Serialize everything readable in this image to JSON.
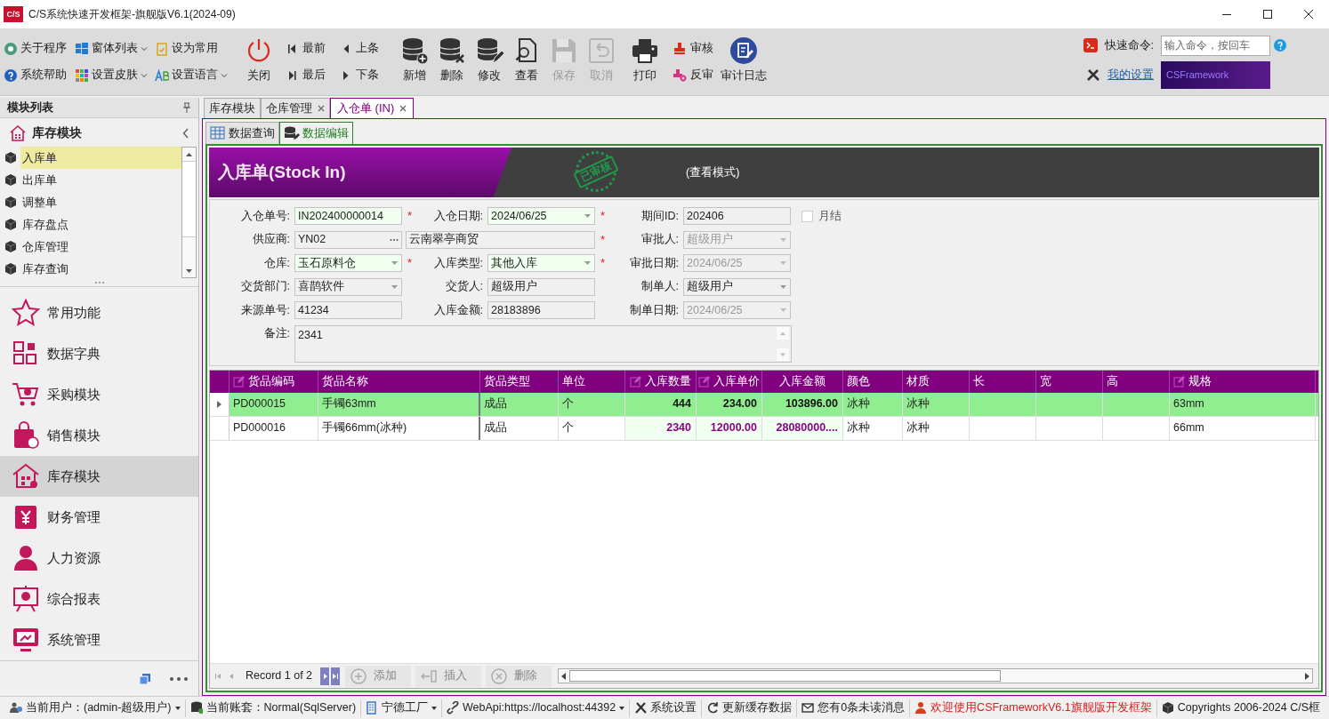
{
  "window": {
    "logo": "C/S",
    "title": "C/S系统快速开发框架-旗舰版V6.1(2024-09)"
  },
  "toolbar": {
    "menu_buttons": [
      {
        "label": "关于程序",
        "dropdown": false
      },
      {
        "label": "窗体列表",
        "dropdown": true
      },
      {
        "label": "设为常用",
        "dropdown": false
      },
      {
        "label": "系统帮助",
        "dropdown": false
      },
      {
        "label": "设置皮肤",
        "dropdown": true
      },
      {
        "label": "设置语言",
        "dropdown": true
      }
    ],
    "close": "关闭",
    "nav_buttons": [
      "最前",
      "上条",
      "最后",
      "下条"
    ],
    "actions": [
      {
        "label": "新增",
        "disabled": false
      },
      {
        "label": "删除",
        "disabled": false
      },
      {
        "label": "修改",
        "disabled": false
      },
      {
        "label": "查看",
        "disabled": false
      },
      {
        "label": "保存",
        "disabled": true
      },
      {
        "label": "取消",
        "disabled": true
      },
      {
        "label": "打印",
        "disabled": false
      }
    ],
    "audit_buttons": [
      "审核",
      "反审"
    ],
    "audit_log": "审计日志",
    "quick_command": {
      "label": "快速命令:",
      "placeholder": "输入命令，按回车"
    },
    "my_settings": "我的设置",
    "banner": "CSFramework"
  },
  "sidebar": {
    "title": "模块列表",
    "group": "库存模块",
    "items": [
      {
        "label": "入库单",
        "selected": true
      },
      {
        "label": "出库单",
        "selected": false
      },
      {
        "label": "调整单",
        "selected": false
      },
      {
        "label": "库存盘点",
        "selected": false
      },
      {
        "label": "仓库管理",
        "selected": false
      },
      {
        "label": "库存查询",
        "selected": false
      }
    ],
    "modules": [
      {
        "label": "常用功能",
        "selected": false
      },
      {
        "label": "数据字典",
        "selected": false
      },
      {
        "label": "采购模块",
        "selected": false
      },
      {
        "label": "销售模块",
        "selected": false
      },
      {
        "label": "库存模块",
        "selected": true
      },
      {
        "label": "财务管理",
        "selected": false
      },
      {
        "label": "人力资源",
        "selected": false
      },
      {
        "label": "综合报表",
        "selected": false
      },
      {
        "label": "系统管理",
        "selected": false
      }
    ]
  },
  "doc_tabs": [
    {
      "label": "库存模块",
      "closable": false,
      "selected": false
    },
    {
      "label": "仓库管理",
      "closable": true,
      "selected": false
    },
    {
      "label": "入仓单 (IN)",
      "closable": true,
      "selected": true
    }
  ],
  "sub_tabs": [
    {
      "label": "数据查询",
      "selected": false
    },
    {
      "label": "数据编辑",
      "selected": true
    }
  ],
  "header": {
    "title": "入库单(Stock In)",
    "stamp": "已审核",
    "mode": "(查看模式)"
  },
  "form": {
    "rows": [
      [
        {
          "label": "入仓单号:",
          "value": "IN202400000014",
          "kind": "text",
          "required": "*",
          "highlighted": true,
          "disabled": false
        },
        {
          "label": "入仓日期:",
          "value": "2024/06/25",
          "kind": "dropdown",
          "required": "*",
          "highlighted": true,
          "disabled": false
        },
        {
          "label": "期间ID:",
          "value": "202406",
          "kind": "text",
          "highlighted": false,
          "disabled": false
        },
        {
          "label": "月结",
          "kind": "checkbox",
          "checked": false
        }
      ],
      [
        {
          "label": "供应商:",
          "value": "YN02",
          "kind": "lookup",
          "highlighted": false,
          "disabled": false
        },
        {
          "value": "云南翠亭商贸",
          "kind": "name",
          "required": "*",
          "highlighted": false,
          "disabled": false
        },
        {
          "label": "审批人:",
          "value": "超级用户",
          "kind": "dropdown",
          "highlighted": false,
          "disabled": true
        }
      ],
      [
        {
          "label": "仓库:",
          "value": "玉石原料仓",
          "kind": "dropdown",
          "required": "*",
          "highlighted": true,
          "disabled": false
        },
        {
          "label": "入库类型:",
          "value": "其他入库",
          "kind": "dropdown",
          "required": "*",
          "highlighted": true,
          "disabled": false
        },
        {
          "label": "审批日期:",
          "value": "2024/06/25",
          "kind": "dropdown",
          "highlighted": false,
          "disabled": true
        }
      ],
      [
        {
          "label": "交货部门:",
          "value": "喜鹊软件",
          "kind": "dropdown",
          "highlighted": false,
          "disabled": false
        },
        {
          "label": "交货人:",
          "value": "超级用户",
          "kind": "text",
          "highlighted": false,
          "disabled": false
        },
        {
          "label": "制单人:",
          "value": "超级用户",
          "kind": "dropdown",
          "highlighted": false,
          "disabled": false
        }
      ],
      [
        {
          "label": "来源单号:",
          "value": "41234",
          "kind": "text",
          "highlighted": false,
          "disabled": false
        },
        {
          "label": "入库金额:",
          "value": "28183896",
          "kind": "text",
          "highlighted": false,
          "disabled": false
        },
        {
          "label": "制单日期:",
          "value": "2024/06/25",
          "kind": "dropdown",
          "highlighted": false,
          "disabled": true
        }
      ],
      [
        {
          "label": "备注:",
          "value": "2341",
          "kind": "memo",
          "highlighted": false,
          "disabled": false
        }
      ]
    ]
  },
  "grid": {
    "columns": [
      {
        "label": "货品编码",
        "editable": true,
        "kind": "text"
      },
      {
        "label": "货品名称",
        "editable": false,
        "kind": "text"
      },
      {
        "label": "货品类型",
        "editable": false,
        "kind": "text"
      },
      {
        "label": "单位",
        "editable": false,
        "kind": "text"
      },
      {
        "label": "入库数量",
        "editable": true,
        "kind": "number"
      },
      {
        "label": "入库单价",
        "editable": true,
        "kind": "number"
      },
      {
        "label": "入库金额",
        "editable": false,
        "kind": "number"
      },
      {
        "label": "颜色",
        "editable": false,
        "kind": "text"
      },
      {
        "label": "材质",
        "editable": false,
        "kind": "text"
      },
      {
        "label": "长",
        "editable": false,
        "kind": "text"
      },
      {
        "label": "宽",
        "editable": false,
        "kind": "text"
      },
      {
        "label": "高",
        "editable": false,
        "kind": "text"
      },
      {
        "label": "规格",
        "editable": true,
        "kind": "text"
      }
    ],
    "rows": [
      {
        "selected": true,
        "cells": [
          "PD000015",
          "手镯63mm",
          "成品",
          "个",
          "444",
          "234.00",
          "103896.00",
          "冰种",
          "冰种",
          "",
          "",
          "",
          "63mm"
        ]
      },
      {
        "selected": false,
        "cells": [
          "PD000016",
          "手镯66mm(冰种)",
          "成品",
          "个",
          "2340",
          "12000.00",
          "28080000....",
          "冰种",
          "冰种",
          "",
          "",
          "",
          "66mm"
        ]
      }
    ],
    "navigator": {
      "record": "Record 1 of 2",
      "buttons": [
        {
          "label": "添加",
          "disabled": true
        },
        {
          "label": "插入",
          "disabled": true
        },
        {
          "label": "删除",
          "disabled": true
        }
      ]
    }
  },
  "status_bar": [
    {
      "label": "当前用户：(admin-超级用户)",
      "dropdown": true,
      "kind": "normal"
    },
    {
      "label": "当前账套：Normal(SqlServer)",
      "dropdown": false,
      "kind": "normal"
    },
    {
      "label": "宁德工厂",
      "dropdown": true,
      "kind": "normal"
    },
    {
      "label": "WebApi:https://localhost:44392",
      "dropdown": true,
      "kind": "normal"
    },
    {
      "label": "系统设置",
      "dropdown": false,
      "kind": "normal"
    },
    {
      "label": "更新缓存数据",
      "dropdown": false,
      "kind": "normal"
    },
    {
      "label": "您有0条未读消息",
      "dropdown": false,
      "kind": "normal"
    },
    {
      "label": "欢迎使用CSFrameworkV6.1旗舰版开发框架",
      "dropdown": false,
      "kind": "notice"
    },
    {
      "label": "Copyrights 2006-2024 C/S框",
      "dropdown": false,
      "kind": "normal"
    }
  ]
}
